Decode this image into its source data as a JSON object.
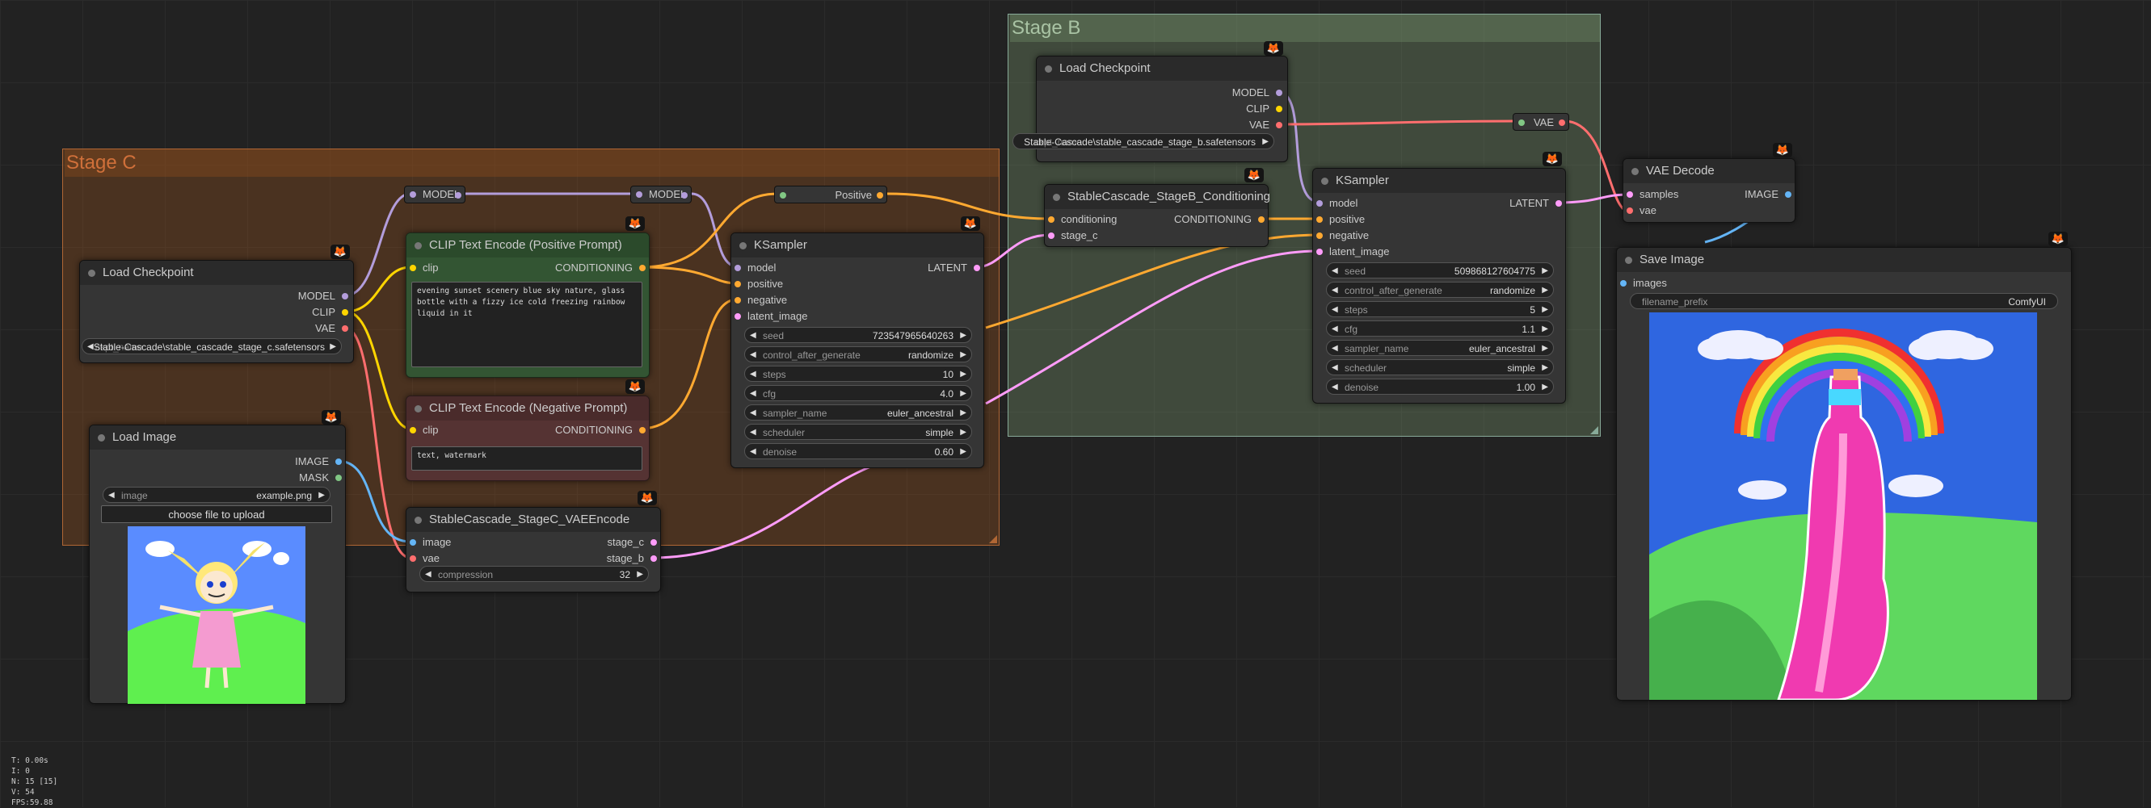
{
  "groups": {
    "stage_c": {
      "title": "Stage C",
      "color": "#b06634"
    },
    "stage_b": {
      "title": "Stage B",
      "color": "#8a9"
    }
  },
  "colors": {
    "model": "#b39ddb",
    "clip": "#ffd500",
    "vae": "#ff6e6e",
    "conditioning": "#ffa931",
    "latent": "#ff9cf9",
    "image": "#64b5f6",
    "mask": "#81c784",
    "positive_node": "#2f4f2f",
    "negative_node": "#4f2f2f"
  },
  "nodes": {
    "load_checkpoint_c": {
      "title": "Load Checkpoint",
      "outputs": [
        "MODEL",
        "CLIP",
        "VAE"
      ],
      "ckpt_name": "Stable-Cascade\\stable_cascade_stage_c.safetensors",
      "ckpt_label": "ckpt_name"
    },
    "load_image": {
      "title": "Load Image",
      "outputs": [
        "IMAGE",
        "MASK"
      ],
      "image_label": "image",
      "image_value": "example.png",
      "upload_label": "choose file to upload"
    },
    "reroute_model_1": {
      "label": "MODEL"
    },
    "reroute_model_2": {
      "label": "MODEL"
    },
    "reroute_positive": {
      "label": "Positive"
    },
    "clip_pos": {
      "title": "CLIP Text Encode (Positive Prompt)",
      "input": "clip",
      "output": "CONDITIONING",
      "text": "evening sunset scenery blue sky nature, glass bottle with a fizzy ice cold freezing rainbow liquid in it"
    },
    "clip_neg": {
      "title": "CLIP Text Encode (Negative Prompt)",
      "input": "clip",
      "output": "CONDITIONING",
      "text": "text, watermark"
    },
    "vae_encode_c": {
      "title": "StableCascade_StageC_VAEEncode",
      "inputs": [
        "image",
        "vae"
      ],
      "outputs": [
        "stage_c",
        "stage_b"
      ],
      "compression_label": "compression",
      "compression_value": "32"
    },
    "ksampler_c": {
      "title": "KSampler",
      "inputs": [
        "model",
        "positive",
        "negative",
        "latent_image"
      ],
      "output": "LATENT",
      "widgets": [
        {
          "label": "seed",
          "value": "723547965640263"
        },
        {
          "label": "control_after_generate",
          "value": "randomize"
        },
        {
          "label": "steps",
          "value": "10"
        },
        {
          "label": "cfg",
          "value": "4.0"
        },
        {
          "label": "sampler_name",
          "value": "euler_ancestral"
        },
        {
          "label": "scheduler",
          "value": "simple"
        },
        {
          "label": "denoise",
          "value": "0.60"
        }
      ]
    },
    "load_checkpoint_b": {
      "title": "Load Checkpoint",
      "outputs": [
        "MODEL",
        "CLIP",
        "VAE"
      ],
      "ckpt_name": "Stable-Cascade\\stable_cascade_stage_b.safetensors",
      "ckpt_label": "ckpt_name"
    },
    "stageb_cond": {
      "title": "StableCascade_StageB_Conditioning",
      "inputs": [
        "conditioning",
        "stage_c"
      ],
      "output": "CONDITIONING"
    },
    "reroute_vae": {
      "label": "VAE"
    },
    "ksampler_b": {
      "title": "KSampler",
      "inputs": [
        "model",
        "positive",
        "negative",
        "latent_image"
      ],
      "output": "LATENT",
      "widgets": [
        {
          "label": "seed",
          "value": "509868127604775"
        },
        {
          "label": "control_after_generate",
          "value": "randomize"
        },
        {
          "label": "steps",
          "value": "5"
        },
        {
          "label": "cfg",
          "value": "1.1"
        },
        {
          "label": "sampler_name",
          "value": "euler_ancestral"
        },
        {
          "label": "scheduler",
          "value": "simple"
        },
        {
          "label": "denoise",
          "value": "1.00"
        }
      ]
    },
    "vae_decode": {
      "title": "VAE Decode",
      "inputs": [
        "samples",
        "vae"
      ],
      "output": "IMAGE"
    },
    "save_image": {
      "title": "Save Image",
      "input": "images",
      "prefix_label": "filename_prefix",
      "prefix_value": "ComfyUI"
    }
  },
  "stats": {
    "t": "T: 0.00s",
    "i": "I: 0",
    "n": "N: 15 [15]",
    "v": "V: 54",
    "fps": "FPS:59.88"
  }
}
